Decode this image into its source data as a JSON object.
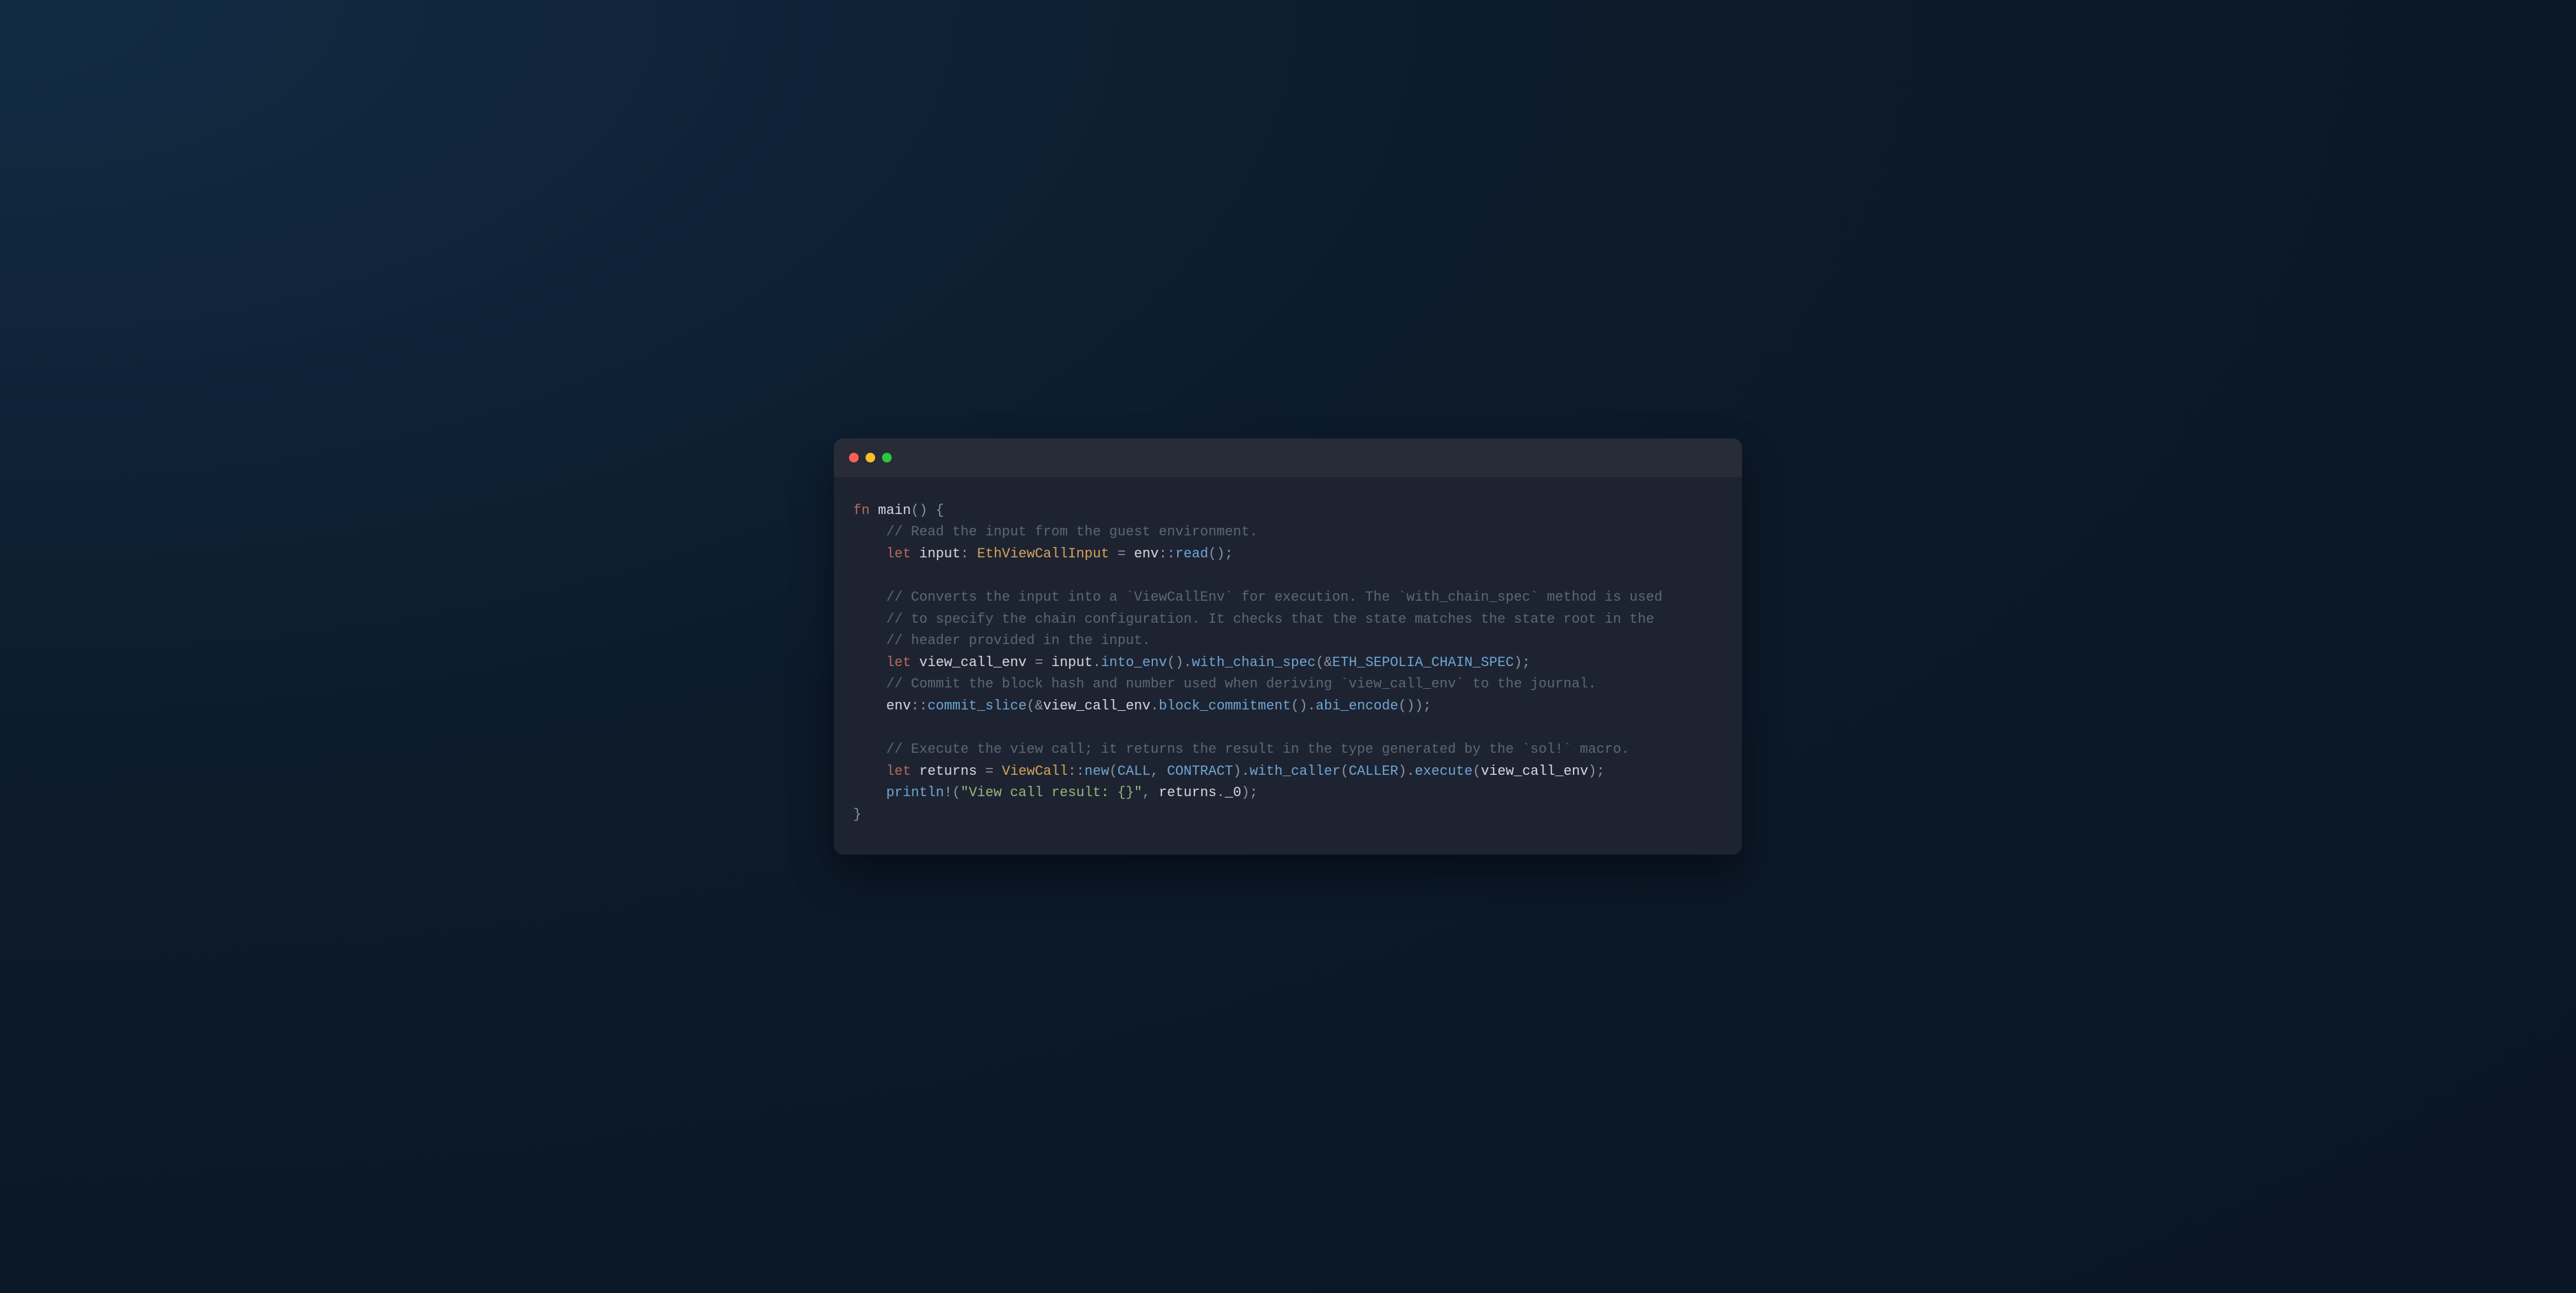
{
  "window": {
    "traffic_lights": [
      "close",
      "minimize",
      "zoom"
    ]
  },
  "colors": {
    "keyword": "#b96a60",
    "identifier": "#d6d9df",
    "type": "#d9a35c",
    "punct": "#8b93a3",
    "function": "#6fa6d6",
    "comment": "#5c6779",
    "string": "#97b77d",
    "constant": "#6fa6d6"
  },
  "code": {
    "lines": [
      [
        [
          "kw",
          "fn"
        ],
        [
          "ident",
          " main"
        ],
        [
          "punct",
          "()"
        ],
        [
          "punct",
          " {"
        ]
      ],
      [
        [
          "indent",
          "    "
        ],
        [
          "comment",
          "// Read the input from the guest environment."
        ]
      ],
      [
        [
          "indent",
          "    "
        ],
        [
          "kw",
          "let"
        ],
        [
          "ident",
          " input"
        ],
        [
          "punct",
          ": "
        ],
        [
          "type",
          "EthViewCallInput"
        ],
        [
          "punct",
          " = "
        ],
        [
          "ident",
          "env"
        ],
        [
          "punct",
          "::"
        ],
        [
          "func",
          "read"
        ],
        [
          "punct",
          "();"
        ]
      ],
      [
        [
          "blank",
          ""
        ]
      ],
      [
        [
          "indent",
          "    "
        ],
        [
          "comment",
          "// Converts the input into a `ViewCallEnv` for execution. The `with_chain_spec` method is used"
        ]
      ],
      [
        [
          "indent",
          "    "
        ],
        [
          "comment",
          "// to specify the chain configuration. It checks that the state matches the state root in the"
        ]
      ],
      [
        [
          "indent",
          "    "
        ],
        [
          "comment",
          "// header provided in the input."
        ]
      ],
      [
        [
          "indent",
          "    "
        ],
        [
          "kw",
          "let"
        ],
        [
          "ident",
          " view_call_env"
        ],
        [
          "punct",
          " = "
        ],
        [
          "ident",
          "input"
        ],
        [
          "punct",
          "."
        ],
        [
          "func",
          "into_env"
        ],
        [
          "punct",
          "()"
        ],
        [
          "punct",
          "."
        ],
        [
          "func",
          "with_chain_spec"
        ],
        [
          "punct",
          "("
        ],
        [
          "punct",
          "&"
        ],
        [
          "const",
          "ETH_SEPOLIA_CHAIN_SPEC"
        ],
        [
          "punct",
          ");"
        ]
      ],
      [
        [
          "indent",
          "    "
        ],
        [
          "comment",
          "// Commit the block hash and number used when deriving `view_call_env` to the journal."
        ]
      ],
      [
        [
          "indent",
          "    "
        ],
        [
          "ident",
          "env"
        ],
        [
          "punct",
          "::"
        ],
        [
          "func",
          "commit_slice"
        ],
        [
          "punct",
          "("
        ],
        [
          "punct",
          "&"
        ],
        [
          "ident",
          "view_call_env"
        ],
        [
          "punct",
          "."
        ],
        [
          "func",
          "block_commitment"
        ],
        [
          "punct",
          "()"
        ],
        [
          "punct",
          "."
        ],
        [
          "func",
          "abi_encode"
        ],
        [
          "punct",
          "());"
        ]
      ],
      [
        [
          "blank",
          ""
        ]
      ],
      [
        [
          "indent",
          "    "
        ],
        [
          "comment",
          "// Execute the view call; it returns the result in the type generated by the `sol!` macro."
        ]
      ],
      [
        [
          "indent",
          "    "
        ],
        [
          "kw",
          "let"
        ],
        [
          "ident",
          " returns"
        ],
        [
          "punct",
          " = "
        ],
        [
          "type",
          "ViewCall"
        ],
        [
          "punct",
          "::"
        ],
        [
          "func",
          "new"
        ],
        [
          "punct",
          "("
        ],
        [
          "const",
          "CALL"
        ],
        [
          "punct",
          ", "
        ],
        [
          "const",
          "CONTRACT"
        ],
        [
          "punct",
          ")"
        ],
        [
          "punct",
          "."
        ],
        [
          "func",
          "with_caller"
        ],
        [
          "punct",
          "("
        ],
        [
          "const",
          "CALLER"
        ],
        [
          "punct",
          ")"
        ],
        [
          "punct",
          "."
        ],
        [
          "func",
          "execute"
        ],
        [
          "punct",
          "("
        ],
        [
          "ident",
          "view_call_env"
        ],
        [
          "punct",
          ");"
        ]
      ],
      [
        [
          "indent",
          "    "
        ],
        [
          "macro",
          "println!"
        ],
        [
          "punct",
          "("
        ],
        [
          "string",
          "\"View call result: {}\""
        ],
        [
          "punct",
          ", "
        ],
        [
          "ident",
          "returns"
        ],
        [
          "punct",
          "."
        ],
        [
          "ident",
          "_0"
        ],
        [
          "punct",
          ");"
        ]
      ],
      [
        [
          "punct",
          "}"
        ]
      ]
    ]
  }
}
